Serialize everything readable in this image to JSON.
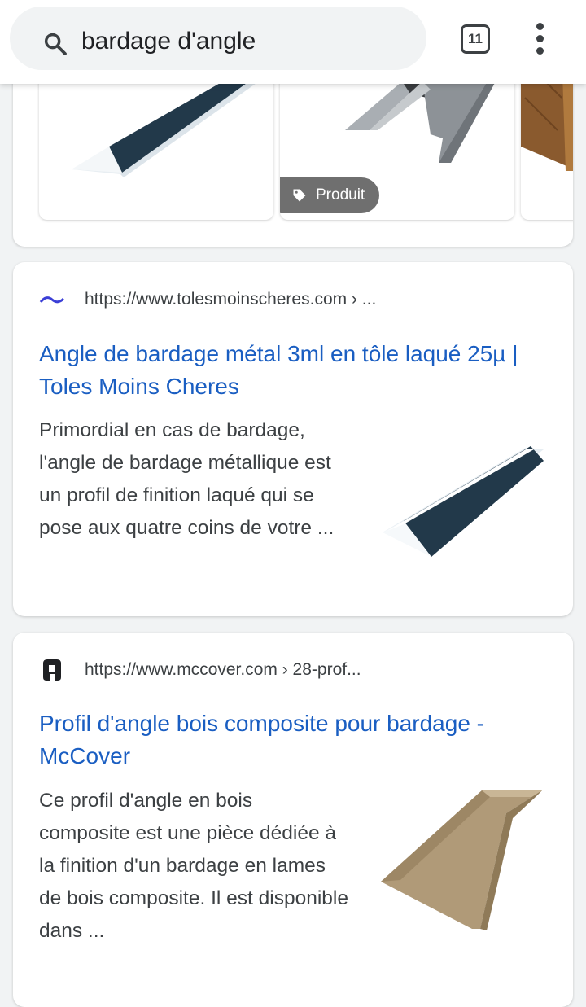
{
  "search": {
    "query": "bardage d'angle"
  },
  "header": {
    "tab_count": "11"
  },
  "image_strip": {
    "badge_label": "Produit"
  },
  "results": [
    {
      "url": "https://www.tolesmoinscheres.com › ...",
      "title": "Angle de bardage métal 3ml en tôle laqué 25µ | Toles Moins Cheres",
      "snippet": "Primordial en cas de bardage, l'angle de bardage métallique est un profil de finition laqué qui se pose aux quatre coins de votre ..."
    },
    {
      "url": "https://www.mccover.com › 28-prof...",
      "title": "Profil d'angle bois composite pour bardage - McCover",
      "snippet": "Ce profil d'angle en bois composite est une pièce dédiée à la finition d'un bardage en lames de bois composite. Il est disponible dans ..."
    }
  ],
  "colors": {
    "link": "#1a5ec2",
    "badge": "#6f6f6f",
    "metal_profile": "#22394a",
    "composite_profile": "#b09a78"
  }
}
